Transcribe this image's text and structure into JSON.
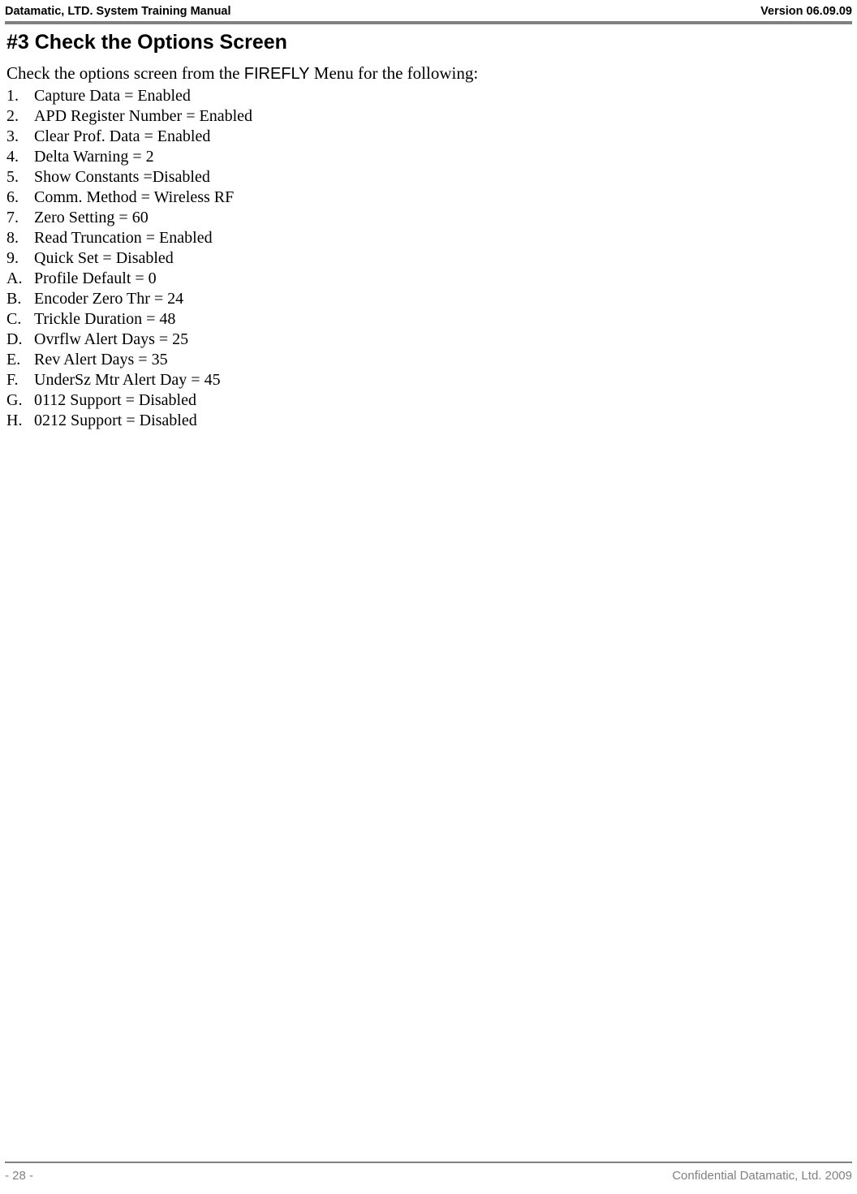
{
  "header": {
    "left": "Datamatic, LTD. System Training  Manual",
    "right": "Version 06.09.09"
  },
  "section_title": "#3 Check the Options Screen",
  "intro_pre": "Check the options screen from the ",
  "intro_mid": "FIREFLY",
  "intro_post": " Menu for the following:",
  "options": [
    {
      "marker": "1.",
      "text": "Capture Data = Enabled"
    },
    {
      "marker": "2.",
      "text": "APD Register Number = Enabled"
    },
    {
      "marker": "3.",
      "text": "Clear Prof. Data = Enabled"
    },
    {
      "marker": "4.",
      "text": "Delta Warning = 2"
    },
    {
      "marker": "5.",
      "text": "Show Constants =Disabled"
    },
    {
      "marker": "6.",
      "text": "Comm. Method = Wireless RF"
    },
    {
      "marker": "7.",
      "text": "Zero Setting = 60"
    },
    {
      "marker": "8.",
      "text": "Read Truncation = Enabled"
    },
    {
      "marker": "9.",
      "text": "Quick Set = Disabled"
    },
    {
      "marker": "A.",
      "text": "Profile Default = 0"
    },
    {
      "marker": "B.",
      "text": "Encoder Zero Thr = 24"
    },
    {
      "marker": "C.",
      "text": "Trickle Duration = 48"
    },
    {
      "marker": "D.",
      "text": "Ovrflw Alert Days = 25"
    },
    {
      "marker": "E.",
      "text": "Rev Alert Days = 35"
    },
    {
      "marker": "F.",
      "text": "UnderSz Mtr Alert Day = 45"
    },
    {
      "marker": "G.",
      "text": "0112 Support = Disabled"
    },
    {
      "marker": "H.",
      "text": "0212 Support = Disabled"
    }
  ],
  "footer": {
    "left": "- 28 -",
    "right": "Confidential Datamatic, Ltd. 2009"
  }
}
